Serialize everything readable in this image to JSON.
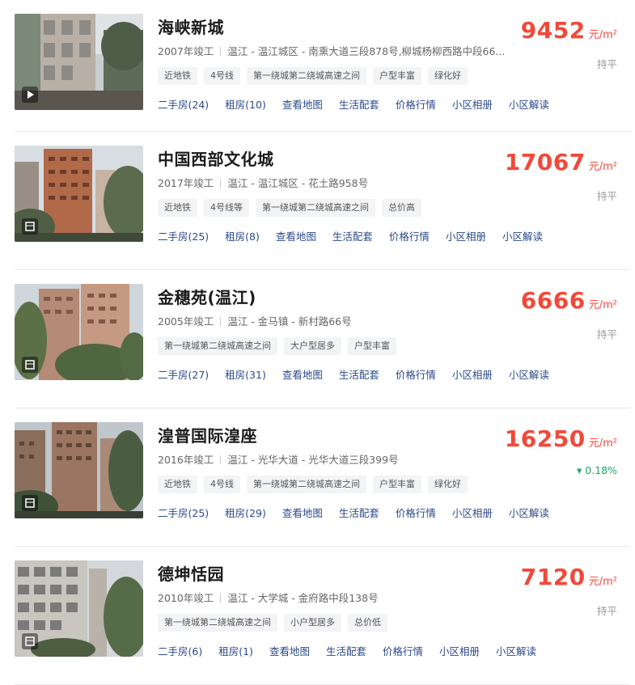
{
  "communities": [
    {
      "name": "海峡新城",
      "year": "2007年竣工",
      "location": "温江 - 温江城区 - 南熏大道三段878号,柳城杨柳西路中段66...",
      "tags": [
        "近地铁",
        "4号线",
        "第一绕城第二绕城高速之间",
        "户型丰富",
        "绿化好"
      ],
      "links": [
        "二手房(24)",
        "租房(10)",
        "查看地图",
        "生活配套",
        "价格行情",
        "小区相册",
        "小区解读"
      ],
      "price": "9452",
      "unit": "元/m²",
      "trend": "持平",
      "badge": "play-icon"
    },
    {
      "name": "中国西部文化城",
      "year": "2017年竣工",
      "location": "温江 - 温江城区 - 花土路958号",
      "tags": [
        "近地铁",
        "4号线等",
        "第一绕城第二绕城高速之间",
        "总价高"
      ],
      "links": [
        "二手房(25)",
        "租房(8)",
        "查看地图",
        "生活配套",
        "价格行情",
        "小区相册",
        "小区解读"
      ],
      "price": "17067",
      "unit": "元/m²",
      "trend": "持平",
      "badge": "album-icon"
    },
    {
      "name": "金穗苑(温江)",
      "year": "2005年竣工",
      "location": "温江 - 金马镇 - 新村路66号",
      "tags": [
        "第一绕城第二绕城高速之间",
        "大户型居多",
        "户型丰富"
      ],
      "links": [
        "二手房(27)",
        "租房(31)",
        "查看地图",
        "生活配套",
        "价格行情",
        "小区相册",
        "小区解读"
      ],
      "price": "6666",
      "unit": "元/m²",
      "trend": "持平",
      "badge": "album-icon"
    },
    {
      "name": "湟普国际湟座",
      "year": "2016年竣工",
      "location": "温江 - 光华大道 - 光华大道三段399号",
      "tags": [
        "近地铁",
        "4号线",
        "第一绕城第二绕城高速之间",
        "户型丰富",
        "绿化好"
      ],
      "links": [
        "二手房(25)",
        "租房(29)",
        "查看地图",
        "生活配套",
        "价格行情",
        "小区相册",
        "小区解读"
      ],
      "price": "16250",
      "unit": "元/m²",
      "trend": "▾ 0.18%",
      "trend_up": true,
      "badge": "album-icon"
    },
    {
      "name": "德坤恬园",
      "year": "2010年竣工",
      "location": "温江 - 大学城 - 金府路中段138号",
      "tags": [
        "第一绕城第二绕城高速之间",
        "小户型居多",
        "总价低"
      ],
      "links": [
        "二手房(6)",
        "租房(1)",
        "查看地图",
        "生活配套",
        "价格行情",
        "小区相册",
        "小区解读"
      ],
      "price": "7120",
      "unit": "元/m²",
      "trend": "持平",
      "badge": "album-icon"
    }
  ],
  "colors": {
    "price": "#f0493a",
    "link": "#2a4a8a",
    "trend_down": "#1aa863"
  }
}
